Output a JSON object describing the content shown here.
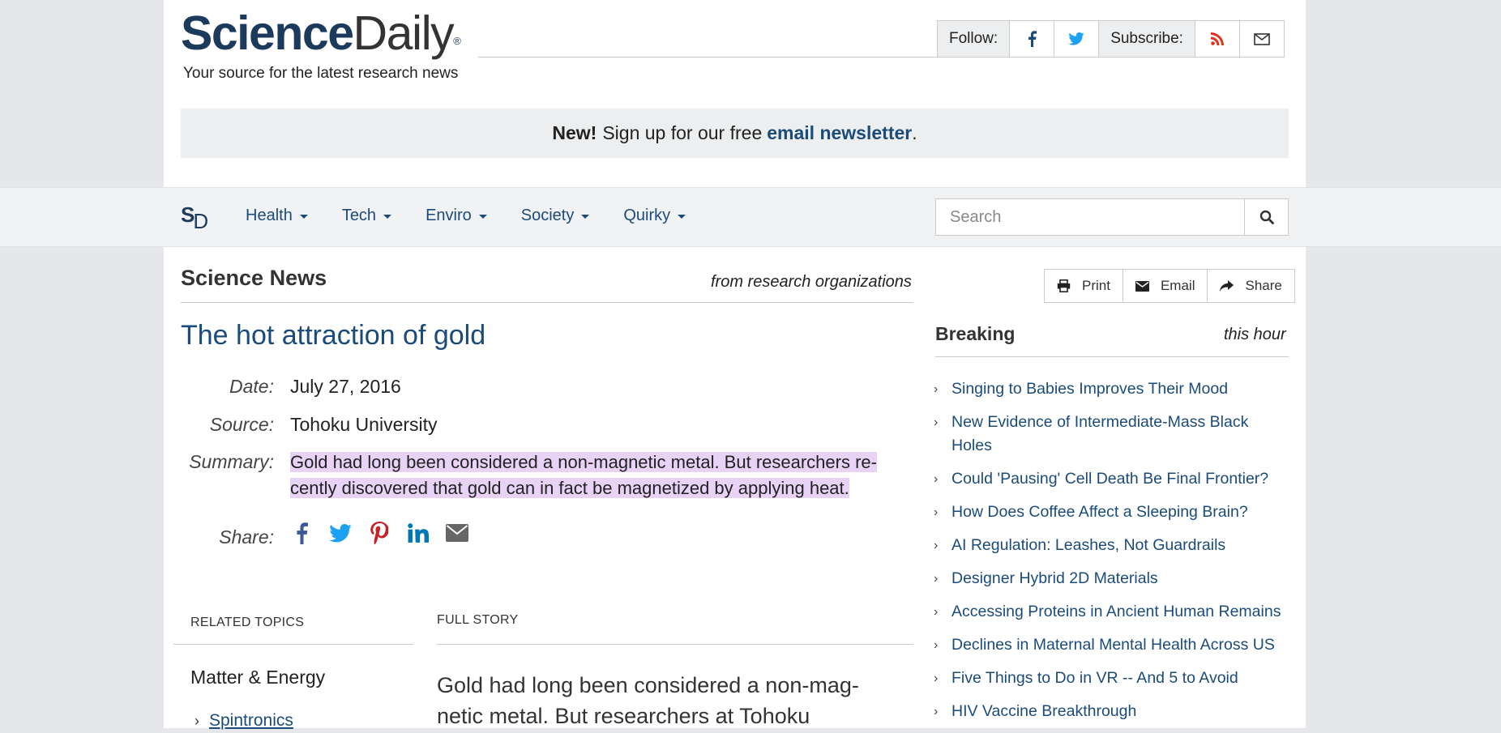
{
  "header": {
    "logo_bold": "Science",
    "logo_light": "Daily",
    "logo_mark": "®",
    "tagline": "Your source for the latest research news",
    "follow_label": "Follow:",
    "subscribe_label": "Subscribe:"
  },
  "newsletter": {
    "new": "New!",
    "text": "Sign up for our free",
    "link": "email newsletter",
    "end": "."
  },
  "nav": {
    "logo_s": "S",
    "logo_d": "D",
    "items": [
      "Health",
      "Tech",
      "Enviro",
      "Society",
      "Quirky"
    ],
    "search_placeholder": "Search"
  },
  "section": {
    "title": "Science News",
    "subtitle": "from research organizations"
  },
  "article": {
    "title": "The hot attraction of gold",
    "date_label": "Date:",
    "date": "July 27, 2016",
    "source_label": "Source:",
    "source": "Tohoku University",
    "summary_label": "Summary:",
    "summary_line1": "Gold had long been considered a non-magnetic metal. But researchers re-",
    "summary_line2": "cently discovered that gold can in fact be magnetized by applying heat.",
    "share_label": "Share:"
  },
  "related": {
    "heading": "RELATED TOPICS",
    "topic": "Matter & Energy",
    "link": "Spintronics"
  },
  "full_story": {
    "heading": "FULL STORY",
    "line1": "Gold had long been considered a non-mag-",
    "line2": "netic metal. But researchers at Tohoku"
  },
  "tools": {
    "print": "Print",
    "email": "Email",
    "share": "Share"
  },
  "breaking": {
    "title": "Breaking",
    "subtitle": "this hour",
    "items": [
      "Singing to Babies Improves Their Mood",
      "New Evidence of Intermediate-Mass Black Holes",
      "Could 'Pausing' Cell Death Be Final Frontier?",
      "How Does Coffee Affect a Sleeping Brain?",
      "AI Regulation: Leashes, Not Guardrails",
      "Designer Hybrid 2D Materials",
      "Accessing Proteins in Ancient Human Remains",
      "Declines in Maternal Mental Health Across US",
      "Five Things to Do in VR -- And 5 to Avoid",
      "HIV Vaccine Breakthrough"
    ]
  },
  "colors": {
    "brand": "#1b3a5c",
    "link": "#1b4b7a",
    "highlight": "#e8d2f6",
    "facebook": "#3b5998",
    "twitter": "#1da1f2",
    "pinterest": "#cb2027",
    "linkedin": "#0077b5",
    "rss": "#e0321a"
  }
}
